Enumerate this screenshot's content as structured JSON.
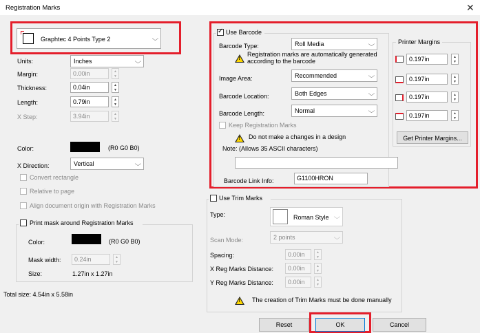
{
  "dialog": {
    "title": "Registration Marks",
    "close_glyph": "✕"
  },
  "mark_type": {
    "selected": "Graphtec 4 Points Type 2",
    "icon": "registration-mark-icon"
  },
  "left": {
    "units_label": "Units:",
    "units_value": "Inches",
    "margin_label": "Margin:",
    "margin_value": "0.00in",
    "thickness_label": "Thickness:",
    "thickness_value": "0.04in",
    "length_label": "Length:",
    "length_value": "0.79in",
    "xstep_label": "X Step:",
    "xstep_value": "3.94in",
    "color_label": "Color:",
    "color_value": "(R0 G0 B0)",
    "color_hex": "#000000",
    "xdir_label": "X Direction:",
    "xdir_value": "Vertical",
    "convert_label": "Convert rectangle",
    "relative_label": "Relative to page",
    "align_label": "Align document origin with Registration Marks",
    "print_mask_label": "Print mask around Registration Marks",
    "mask_color_label": "Color:",
    "mask_color_value": "(R0 G0 B0)",
    "mask_width_label": "Mask width:",
    "mask_width_value": "0.24in",
    "size_label": "Size:",
    "size_value": "1.27in x 1.27in",
    "total_size": "Total size:  4.54in x 5.58in"
  },
  "barcode": {
    "use_label": "Use Barcode",
    "use_checked": true,
    "type_label": "Barcode Type:",
    "type_value": "Roll Media",
    "info_text_1": "Registration marks are automatically generated",
    "info_text_2": "according to the barcode",
    "area_label": "Image Area:",
    "area_value": "Recommended",
    "location_label": "Barcode Location:",
    "location_value": "Both Edges",
    "length_label": "Barcode Length:",
    "length_value": "Normal",
    "keep_label": "Keep Registration Marks",
    "warn_text": "Do not make a changes in a design",
    "note_label": "Note: (Allows 35 ASCII characters)",
    "note_value": "",
    "link_label": "Barcode Link Info:",
    "link_value": "G1100HRON",
    "printer_margins_title": "Printer Margins",
    "margins": [
      "0.197in",
      "0.197in",
      "0.197in",
      "0.197in"
    ],
    "get_margins_label": "Get Printer Margins..."
  },
  "trim": {
    "use_label": "Use Trim Marks",
    "type_label": "Type:",
    "type_value": "Roman Style",
    "scan_label": "Scan Mode:",
    "scan_value": "2 points",
    "spacing_label": "Spacing:",
    "spacing_value": "0.00in",
    "xreg_label": "X Reg Marks Distance:",
    "xreg_value": "0.00in",
    "yreg_label": "Y Reg Marks Distance:",
    "yreg_value": "0.00in",
    "warn_text": "The creation of Trim Marks must be done manually"
  },
  "buttons": {
    "reset": "Reset",
    "ok": "OK",
    "cancel": "Cancel"
  },
  "colors": {
    "highlight": "#e41e2b",
    "accent": "#0078d7"
  }
}
